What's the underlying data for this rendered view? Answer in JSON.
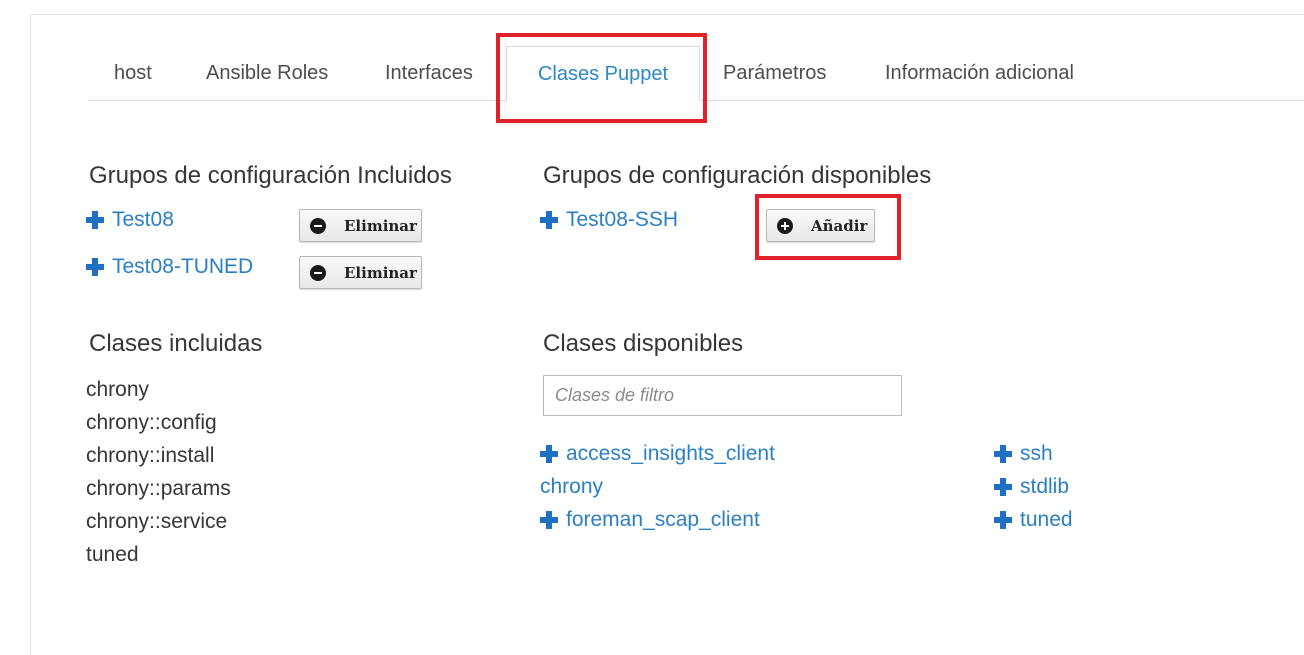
{
  "tabs": [
    {
      "label": "host"
    },
    {
      "label": "Ansible Roles"
    },
    {
      "label": "Interfaces"
    },
    {
      "label": "Clases Puppet",
      "active": true
    },
    {
      "label": "Parámetros"
    },
    {
      "label": "Información adicional"
    }
  ],
  "included_groups": {
    "heading": "Grupos de configuración Incluidos",
    "items": [
      {
        "name": "Test08",
        "button": "Eliminar"
      },
      {
        "name": "Test08-TUNED",
        "button": "Eliminar"
      }
    ]
  },
  "available_groups": {
    "heading": "Grupos de configuración disponibles",
    "items": [
      {
        "name": "Test08-SSH",
        "button": "Añadir"
      }
    ]
  },
  "included_classes": {
    "heading": "Clases incluidas",
    "items": [
      "chrony",
      "chrony::config",
      "chrony::install",
      "chrony::params",
      "chrony::service",
      "tuned"
    ]
  },
  "available_classes": {
    "heading": "Clases disponibles",
    "filter_placeholder": "Clases de filtro",
    "filter_value": "",
    "col1": [
      {
        "name": "access_insights_client",
        "addable": true
      },
      {
        "name": "chrony",
        "addable": false
      },
      {
        "name": "foreman_scap_client",
        "addable": true
      }
    ],
    "col2": [
      {
        "name": "ssh",
        "addable": true
      },
      {
        "name": "stdlib",
        "addable": true
      },
      {
        "name": "tuned",
        "addable": true
      }
    ]
  },
  "colors": {
    "link": "#2b7fc3",
    "plus_icon": "#1f6fc2",
    "highlight": "#e0232a",
    "active_tab": "#2b87c9"
  }
}
